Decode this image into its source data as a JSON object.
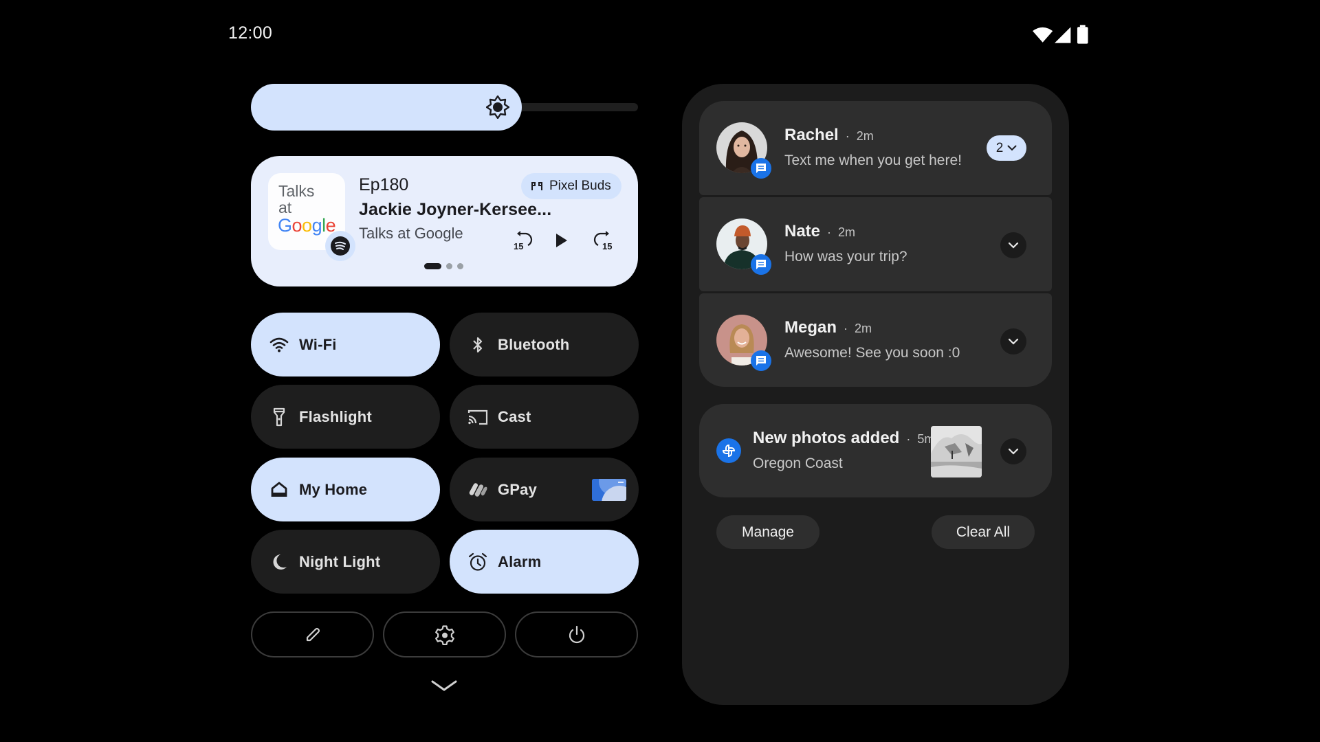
{
  "status_bar": {
    "time": "12:00",
    "icons": [
      "wifi-icon",
      "cellular-signal-icon",
      "battery-icon"
    ]
  },
  "brightness": {
    "level": 0.7,
    "icon": "brightness-icon"
  },
  "media": {
    "album_art": {
      "line1": "Talks",
      "line2": "at",
      "brand": "Google"
    },
    "app_icon": "spotify-icon",
    "episode": "Ep180",
    "title": "Jackie Joyner-Kersee...",
    "artist": "Talks at Google",
    "output_device": "Pixel Buds",
    "output_icon": "earbuds-icon",
    "controls": [
      "rewind-15-icon",
      "play-icon",
      "forward-15-icon"
    ],
    "page_indicator": {
      "count": 3,
      "active": 0
    }
  },
  "tiles": [
    {
      "label": "Wi-Fi",
      "icon": "wifi-icon",
      "on": true
    },
    {
      "label": "Bluetooth",
      "icon": "bluetooth-icon",
      "on": false
    },
    {
      "label": "Flashlight",
      "icon": "flashlight-icon",
      "on": false
    },
    {
      "label": "Cast",
      "icon": "cast-icon",
      "on": false
    },
    {
      "label": "My Home",
      "icon": "home-icon",
      "on": true
    },
    {
      "label": "GPay",
      "icon": "gpay-icon",
      "on": false
    },
    {
      "label": "Night Light",
      "icon": "moon-icon",
      "on": false
    },
    {
      "label": "Alarm",
      "icon": "alarm-icon",
      "on": true
    }
  ],
  "bottom_buttons": [
    {
      "name": "edit",
      "icon": "pencil-icon"
    },
    {
      "name": "settings",
      "icon": "gear-icon"
    },
    {
      "name": "power",
      "icon": "power-icon"
    }
  ],
  "notifications": {
    "conversations": [
      {
        "sender": "Rachel",
        "time": "2m",
        "message": "Text me when you get here!",
        "count": "2",
        "app_icon": "messages-icon"
      },
      {
        "sender": "Nate",
        "time": "2m",
        "message": "How was your trip?",
        "app_icon": "messages-icon"
      },
      {
        "sender": "Megan",
        "time": "2m",
        "message": "Awesome! See you soon :0",
        "app_icon": "messages-icon"
      }
    ],
    "photos": {
      "title": "New photos added",
      "time": "5m",
      "message": "Oregon Coast",
      "app_icon": "photos-icon"
    },
    "separator": "·",
    "manage_label": "Manage",
    "clear_all_label": "Clear All"
  },
  "colors": {
    "accent_container": "#d3e3fd",
    "media_bg": "#e8eefc",
    "tile_off": "#1e1e1e",
    "panel_bg": "#1c1c1c",
    "card_bg": "#2e2e2e",
    "app_badge": "#1a73e8"
  }
}
